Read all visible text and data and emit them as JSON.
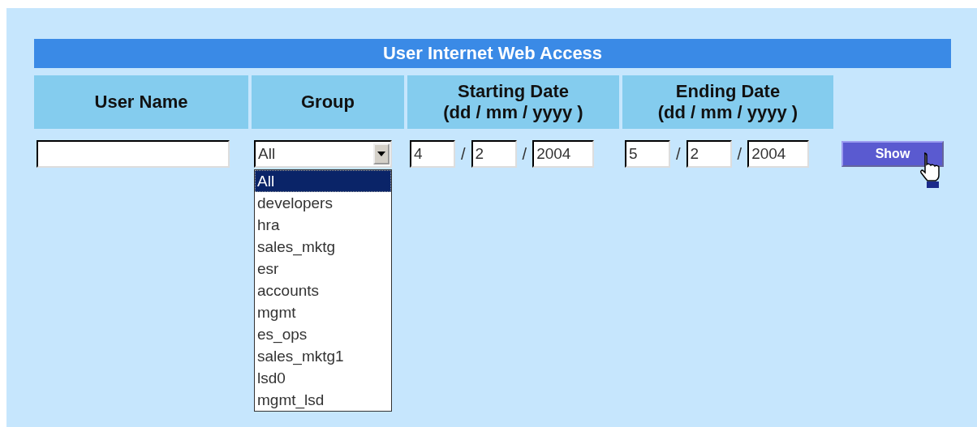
{
  "title": "User Internet Web Access",
  "columns": [
    {
      "label": "User Name"
    },
    {
      "label": "Group"
    },
    {
      "label": "Starting Date",
      "sublabel": "(dd / mm / yyyy )"
    },
    {
      "label": "Ending Date",
      "sublabel": "(dd / mm / yyyy )"
    }
  ],
  "group": {
    "value": "All",
    "expanded": true,
    "options": [
      {
        "label": "All",
        "selected": true
      },
      {
        "label": "developers",
        "selected": false
      },
      {
        "label": "hra",
        "selected": false
      },
      {
        "label": "sales_mktg",
        "selected": false
      },
      {
        "label": "esr",
        "selected": false
      },
      {
        "label": "accounts",
        "selected": false
      },
      {
        "label": "mgmt",
        "selected": false
      },
      {
        "label": "es_ops",
        "selected": false
      },
      {
        "label": "sales_mktg1",
        "selected": false
      },
      {
        "label": "lsd0",
        "selected": false
      },
      {
        "label": "mgmt_lsd",
        "selected": false
      }
    ]
  },
  "starting_date": {
    "day": "4",
    "separator_1": "/",
    "month": "2",
    "separator_2": "/",
    "year": "2004"
  },
  "ending_date": {
    "day": "5",
    "separator_1": "/",
    "month": "2",
    "separator_2": "/",
    "year": "2004"
  },
  "show_button": {
    "label": "Show"
  }
}
